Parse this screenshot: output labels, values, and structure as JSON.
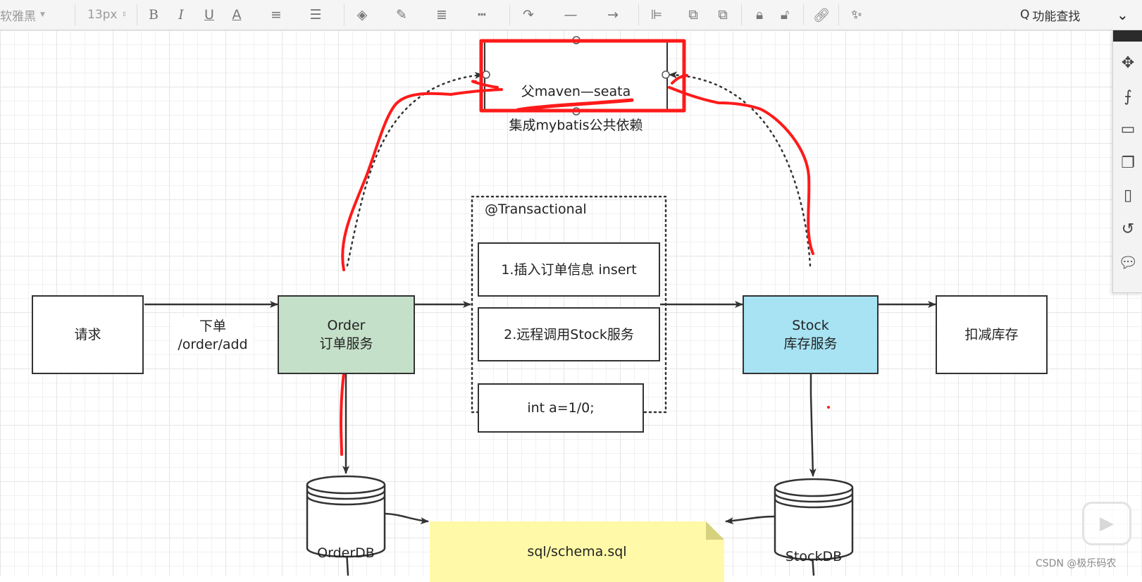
{
  "toolbar": {
    "font_family": "软雅黑",
    "font_size": "13px",
    "bold_icon": "B",
    "italic_icon": "I",
    "underline_icon": "U",
    "font_color_icon": "A",
    "search_label": "功能查找",
    "search_icon": "Q",
    "expand_icon": "chevron-double-down"
  },
  "diagram": {
    "parent_box": {
      "line1": "父maven—seata",
      "line2": "集成mybatis公共依赖"
    },
    "transactional_label": "@Transactional",
    "request_node": "请求",
    "edge_label": {
      "line1": "下单",
      "line2": "/order/add"
    },
    "order_node": {
      "line1": "Order",
      "line2": "订单服务"
    },
    "step1": "1.插入订单信息 insert",
    "step2": "2.远程调用Stock服务",
    "step3": "int a=1/0;",
    "stock_node": {
      "line1": "Stock",
      "line2": "库存服务"
    },
    "deduct_node": "扣减库存",
    "order_db": "OrderDB",
    "stock_db": "StockDB",
    "note": "sql/schema.sql"
  },
  "colors": {
    "order_fill": "#c5e0c9",
    "stock_fill": "#a7e3f3",
    "note_fill": "#fff9a8",
    "annotation_red": "#ff0000"
  },
  "watermark": "CSDN @极乐码农"
}
